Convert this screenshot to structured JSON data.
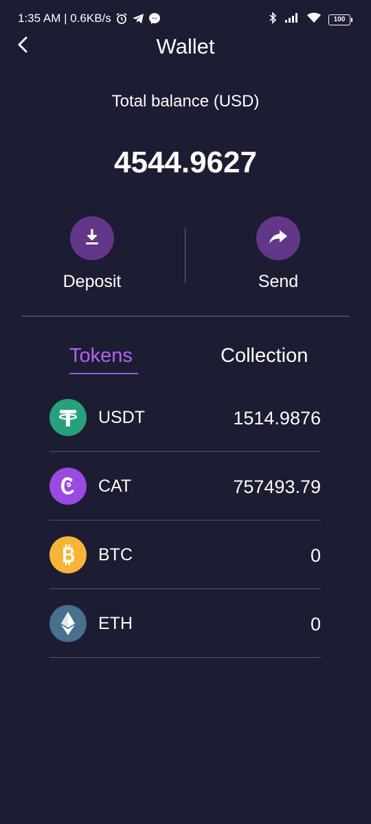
{
  "status_bar": {
    "time_speed": "1:35 AM | 0.6KB/s",
    "battery": "100",
    "icons": [
      "alarm-icon",
      "telegram-icon",
      "messenger-icon",
      "bluetooth-icon",
      "signal-icon",
      "wifi-icon",
      "battery-icon"
    ]
  },
  "header": {
    "title": "Wallet",
    "back_icon": "chevron-left-icon"
  },
  "balance": {
    "label": "Total balance (USD)",
    "value": "4544.9627"
  },
  "actions": {
    "deposit": {
      "label": "Deposit",
      "icon": "download-icon"
    },
    "send": {
      "label": "Send",
      "icon": "share-arrow-icon"
    }
  },
  "tabs": [
    {
      "label": "Tokens",
      "active": true
    },
    {
      "label": "Collection",
      "active": false
    }
  ],
  "tokens": [
    {
      "symbol": "USDT",
      "amount": "1514.9876",
      "icon": "tether-icon",
      "color": "#26a17b"
    },
    {
      "symbol": "CAT",
      "amount": "757493.79",
      "icon": "cat-token-icon",
      "color": "#9a4ae0"
    },
    {
      "symbol": "BTC",
      "amount": "0",
      "icon": "bitcoin-icon",
      "color": "#f7b437"
    },
    {
      "symbol": "ETH",
      "amount": "0",
      "icon": "ethereum-icon",
      "color": "#49708d"
    }
  ],
  "colors": {
    "background": "#1c1c33",
    "accent": "#b264f0",
    "action_circle": "#62378a"
  }
}
